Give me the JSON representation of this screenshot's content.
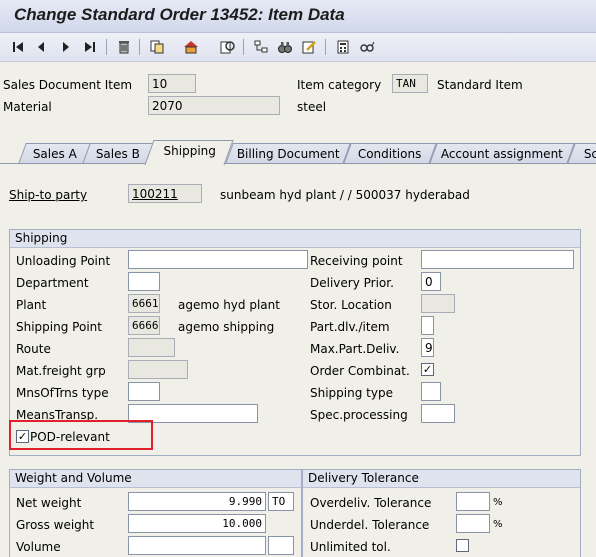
{
  "window": {
    "title": "Change Standard Order 13452: Item Data"
  },
  "toolbar": {
    "icons": [
      "first-page-icon",
      "previous-page-icon",
      "next-page-icon",
      "last-page-icon",
      "delete-icon",
      "copy-item-icon",
      "header-icon",
      "display-doc-flow-icon",
      "status-overview-icon",
      "binoculars-icon",
      "edit-icon",
      "calculator-icon",
      "glasses-icon"
    ]
  },
  "header": {
    "sales_document_item_label": "Sales Document Item",
    "sales_document_item_value": "10",
    "item_category_label": "Item category",
    "item_category_value": "TAN",
    "item_category_text": "Standard Item",
    "material_label": "Material",
    "material_value": "2070",
    "material_text": "steel"
  },
  "tabs": [
    "Sales A",
    "Sales B",
    "Shipping",
    "Billing Document",
    "Conditions",
    "Account assignment",
    "Sc"
  ],
  "active_tab": "Shipping",
  "ship_to": {
    "label": "Ship-to party",
    "value": "100211",
    "text": "sunbeam hyd plant / / 500037 hyderabad"
  },
  "shipping": {
    "title": "Shipping",
    "unloading_point_label": "Unloading Point",
    "unloading_point_value": "",
    "department_label": "Department",
    "department_value": "",
    "plant_label": "Plant",
    "plant_value": "6661",
    "plant_text": "agemo hyd plant",
    "shipping_point_label": "Shipping Point",
    "shipping_point_value": "6666",
    "shipping_point_text": "agemo shipping",
    "route_label": "Route",
    "route_value": "",
    "mat_freight_label": "Mat.freight grp",
    "mat_freight_value": "",
    "mns_of_trns_label": "MnsOfTrns type",
    "mns_of_trns_value": "",
    "means_transp_label": "MeansTransp.",
    "means_transp_value": "",
    "pod_relevant_label": "POD-relevant",
    "pod_relevant_checked": "✓",
    "receiving_point_label": "Receiving point",
    "receiving_point_value": "",
    "delivery_prior_label": "Delivery Prior.",
    "delivery_prior_value": "0",
    "stor_location_label": "Stor. Location",
    "stor_location_value": "",
    "part_dlv_label": "Part.dlv./item",
    "part_dlv_value": "",
    "max_part_deliv_label": "Max.Part.Deliv.",
    "max_part_deliv_value": "9",
    "order_combinat_label": "Order Combinat.",
    "order_combinat_checked": "✓",
    "shipping_type_label": "Shipping type",
    "shipping_type_value": "",
    "spec_processing_label": "Spec.processing",
    "spec_processing_value": ""
  },
  "weight_volume": {
    "title": "Weight and Volume",
    "net_weight_label": "Net weight",
    "net_weight_value": "9.990",
    "net_weight_unit": "TO",
    "gross_weight_label": "Gross weight",
    "gross_weight_value": "10.000",
    "volume_label": "Volume",
    "volume_value": "",
    "volume_unit": ""
  },
  "delivery_tolerance": {
    "title": "Delivery Tolerance",
    "overdeliv_label": "Overdeliv. Tolerance",
    "overdeliv_value": "",
    "overdeliv_unit": "%",
    "underdel_label": "Underdel. Tolerance",
    "underdel_value": "",
    "underdel_unit": "%",
    "unlimited_label": "Unlimited tol.",
    "unlimited_checked": ""
  },
  "colors": {
    "highlight": "#e0202a",
    "group_header": "#dfe3ee",
    "background": "#f0efe8"
  }
}
